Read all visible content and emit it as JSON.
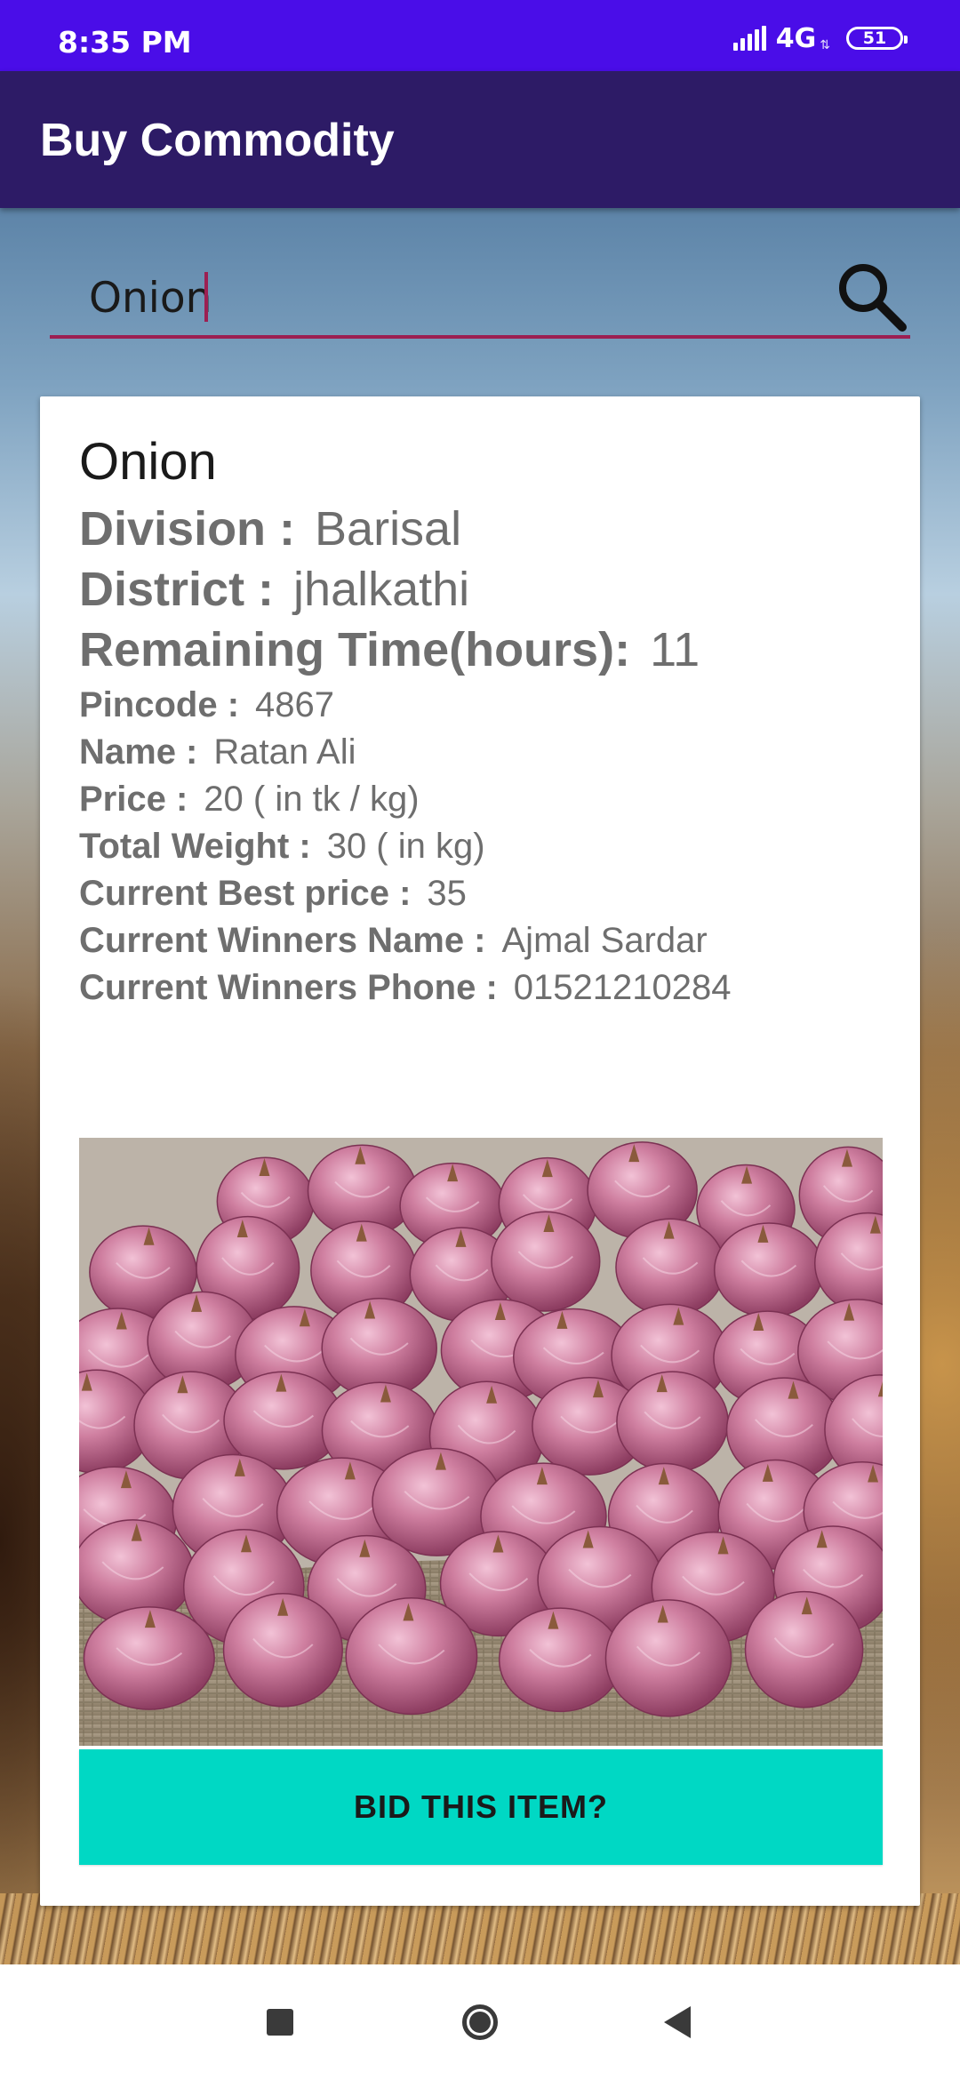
{
  "status_bar": {
    "time": "8:35 PM",
    "network": "4G",
    "battery": "51",
    "icons": [
      "signal-icon",
      "battery-icon"
    ]
  },
  "app_bar": {
    "title": "Buy Commodity"
  },
  "search": {
    "value": "Onion",
    "icon": "search-icon"
  },
  "listing": {
    "commodity": "Onion",
    "fields": {
      "division": {
        "label": "Division :",
        "value": "Barisal"
      },
      "district": {
        "label": "District :",
        "value": "jhalkathi"
      },
      "remaining_time": {
        "label": "Remaining Time(hours):",
        "value": "11"
      },
      "pincode": {
        "label": "Pincode :",
        "value": "4867"
      },
      "name": {
        "label": "Name :",
        "value": "Ratan Ali"
      },
      "price": {
        "label": "Price :",
        "value": "20 ( in tk / kg)"
      },
      "total_weight": {
        "label": "Total Weight :",
        "value": "30 ( in kg)"
      },
      "current_best_price": {
        "label": "Current Best price :",
        "value": "35"
      },
      "current_winners_name": {
        "label": "Current Winners Name :",
        "value": "Ajmal Sardar"
      },
      "current_winners_phone": {
        "label": "Current Winners Phone :",
        "value": "01521210284"
      }
    },
    "image": "onion-photo",
    "bid_button_label": "BID THIS ITEM?"
  },
  "nav_bar": {
    "icons": [
      "recents-icon",
      "home-icon",
      "back-icon"
    ]
  },
  "colors": {
    "status_bar": "#4a0de8",
    "app_bar": "#2d1b66",
    "search_underline": "#9c1f52",
    "bid_button": "#00d8c4",
    "field_text": "#6e6e6e"
  }
}
